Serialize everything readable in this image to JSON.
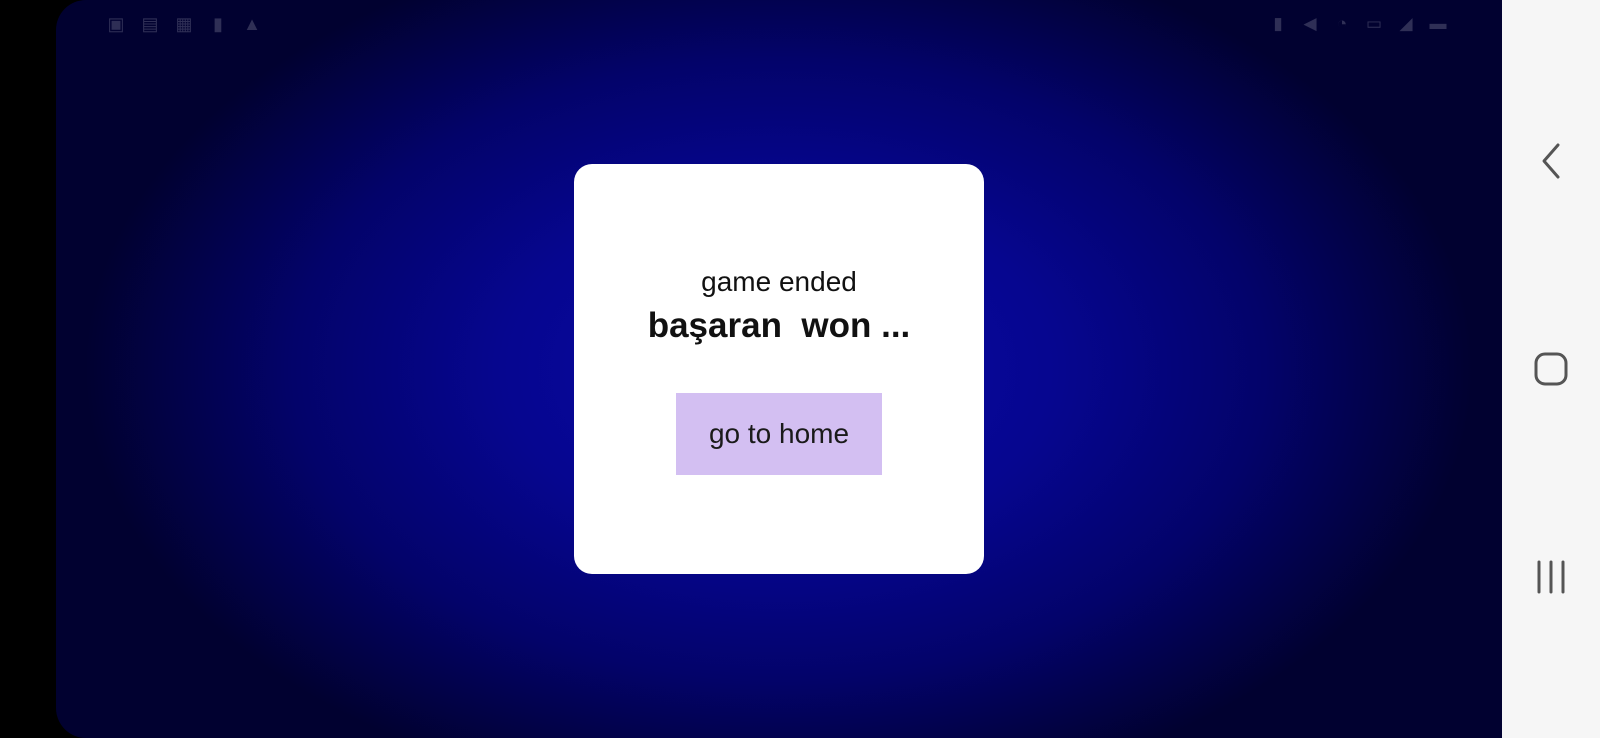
{
  "status_bar": {
    "left_icons": [
      "notification-icon",
      "notification-icon",
      "calendar-icon",
      "sim-icon",
      "warning-icon"
    ],
    "right_icons": [
      "battery-saver-icon",
      "mute-icon",
      "wifi-icon",
      "vpn-icon",
      "signal-icon",
      "battery-icon"
    ]
  },
  "dialog": {
    "subtitle": "game ended",
    "title": "başaran  won ...",
    "button_label": "go to home"
  },
  "nav": {
    "back": "back-icon",
    "home": "home-icon",
    "recents": "recents-icon"
  },
  "colors": {
    "background_center": "#0a0aa8",
    "background_edge": "#010130",
    "dialog_bg": "#ffffff",
    "button_bg": "#d3bff2",
    "nav_bg": "#f6f6f6",
    "nav_icon": "#555555"
  }
}
